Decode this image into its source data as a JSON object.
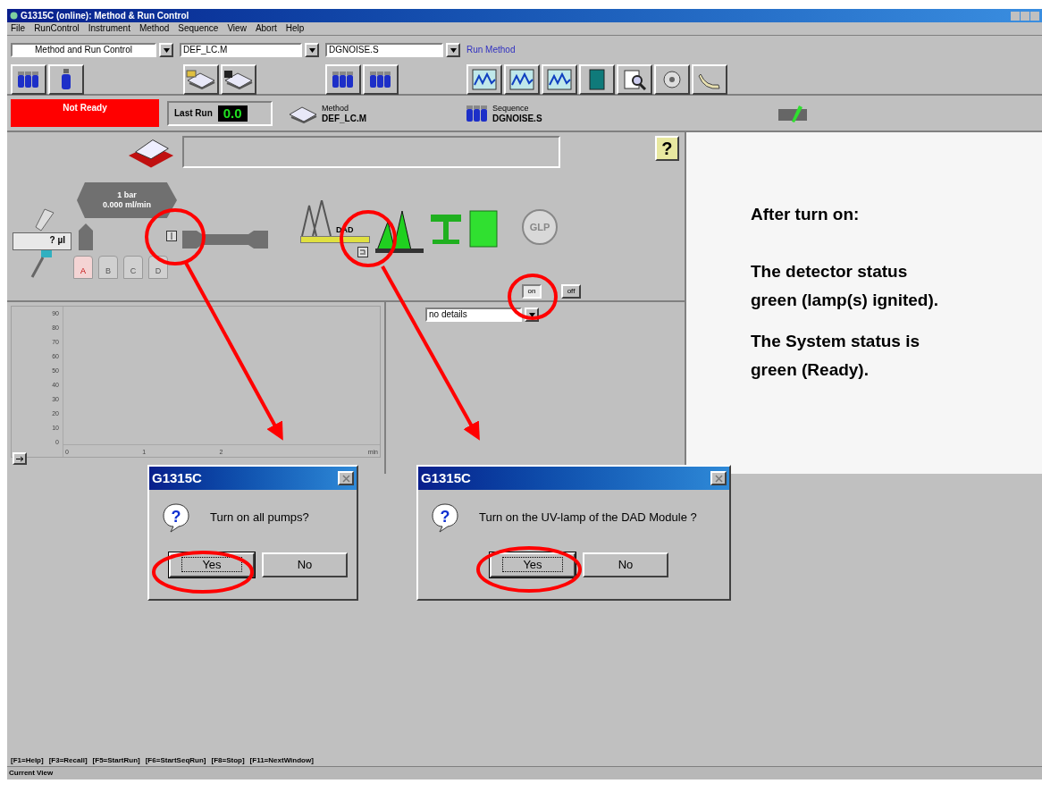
{
  "window": {
    "title": "G1315C (online): Method & Run Control"
  },
  "menu": [
    "File",
    "RunControl",
    "Instrument",
    "Method",
    "Sequence",
    "View",
    "Abort",
    "Help"
  ],
  "toolbar": {
    "view_select": "Method and Run Control",
    "method_select": "DEF_LC.M",
    "sequence_select": "DGNOISE.S",
    "run_label": "Run Method"
  },
  "status": {
    "system": {
      "text": "Not Ready",
      "kind": "not-ready"
    },
    "last_run": {
      "label": "Last Run",
      "value": "0.0"
    },
    "method": {
      "label": "Method",
      "value": "DEF_LC.M"
    },
    "sequence": {
      "label": "Sequence",
      "value": "DGNOISE.S"
    }
  },
  "diagram": {
    "help": "?",
    "injector": "? µl",
    "pump": [
      "1 bar",
      "0.000 ml/min"
    ],
    "detector": "DAD",
    "glp": "GLP",
    "bottles": [
      {
        "label": "A",
        "selected": true
      },
      {
        "label": "B",
        "selected": false
      },
      {
        "label": "C",
        "selected": false
      },
      {
        "label": "D",
        "selected": false
      }
    ],
    "switches": [
      {
        "label": "on",
        "selected": true
      },
      {
        "label": "off",
        "selected": false
      }
    ]
  },
  "plot": {
    "yticks": [
      "90",
      "80",
      "70",
      "60",
      "50",
      "40",
      "30",
      "20",
      "10",
      "0"
    ],
    "xticks": [
      "0",
      "1",
      "2"
    ],
    "unit": "min"
  },
  "details_select": "no details",
  "annotation": [
    "After turn on:",
    "The detector status green (lamp(s) ignited).",
    "The System status is green (Ready)."
  ],
  "dialogs": [
    {
      "title": "G1315C",
      "icon_glyph": "?",
      "message": "Turn on all pumps?",
      "buttons": [
        {
          "label": "Yes",
          "default": true
        },
        {
          "label": "No",
          "default": false
        }
      ]
    },
    {
      "title": "G1315C",
      "icon_glyph": "?",
      "message": "Turn on the UV-lamp of the DAD Module ?",
      "buttons": [
        {
          "label": "Yes",
          "default": true
        },
        {
          "label": "No",
          "default": false
        }
      ]
    }
  ],
  "function_keys": [
    "[F1=Help]",
    "[F3=Recall]",
    "[F5=StartRun]",
    "[F6=StartSeqRun]",
    "[F8=Stop]",
    "[F11=NextWindow]"
  ],
  "status_bar": "Current View"
}
